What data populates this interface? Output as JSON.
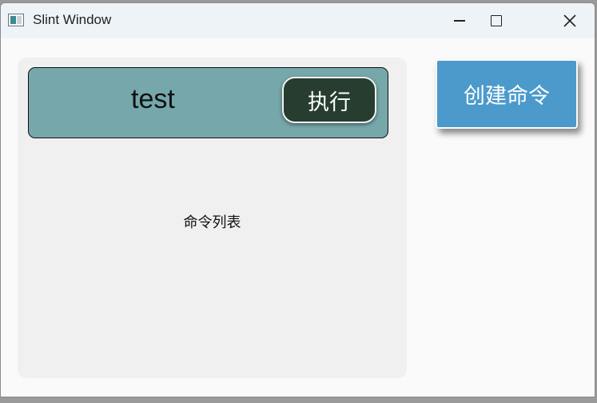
{
  "window": {
    "title": "Slint Window"
  },
  "command_list": {
    "label": "命令列表",
    "items": [
      {
        "name": "test",
        "execute_label": "执行"
      }
    ]
  },
  "actions": {
    "create_label": "创建命令"
  },
  "colors": {
    "command_item_bg": "#76a7aa",
    "execute_button_bg": "#263d30",
    "create_button_bg": "#4b9acb"
  }
}
